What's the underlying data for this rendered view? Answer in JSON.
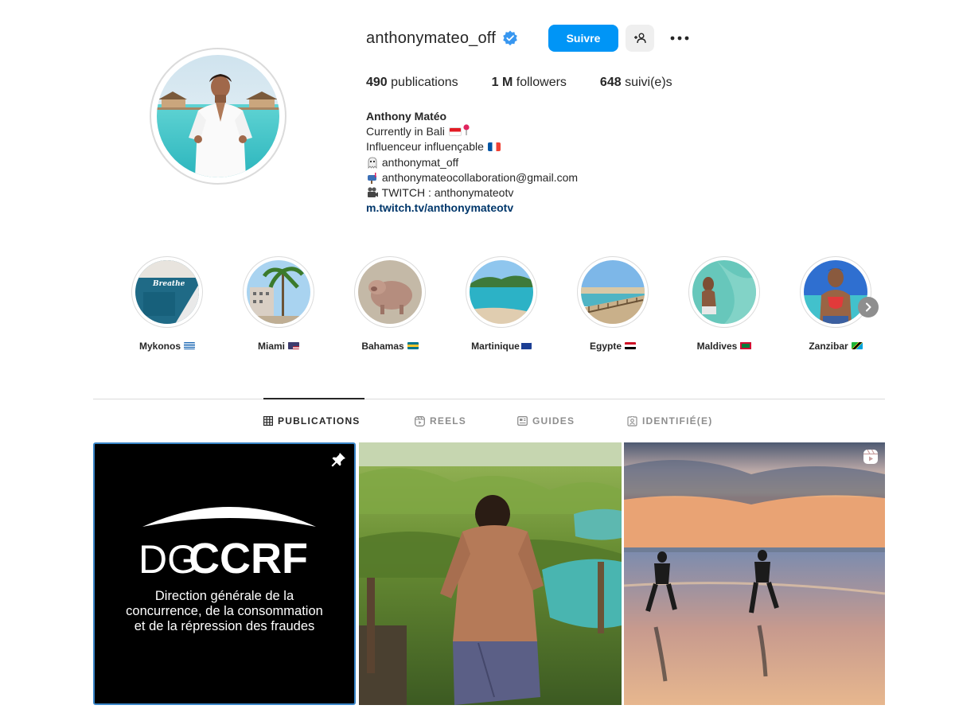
{
  "profile": {
    "username": "anthonymateo_off",
    "follow_label": "Suivre",
    "stats": [
      {
        "value": "490",
        "label": "publications"
      },
      {
        "value": "1 M",
        "label": "followers"
      },
      {
        "value": "648",
        "label": "suivi(e)s"
      }
    ],
    "bio": {
      "name": "Anthony Matéo",
      "line1": "Currently in Bali",
      "line2": "Influenceur influençable",
      "line3": "anthonymat_off",
      "line4": "anthonymateocollaboration@gmail.com",
      "line5": "TWITCH : anthonymateotv",
      "link": "m.twitch.tv/anthonymateotv"
    }
  },
  "highlights": [
    {
      "label": "Mykonos"
    },
    {
      "label": "Miami"
    },
    {
      "label": "Bahamas"
    },
    {
      "label": "Martinique"
    },
    {
      "label": "Egypte"
    },
    {
      "label": "Maldives"
    },
    {
      "label": "Zanzibar"
    }
  ],
  "tabs": [
    {
      "label": "PUBLICATIONS",
      "active": true
    },
    {
      "label": "REELS",
      "active": false
    },
    {
      "label": "GUIDES",
      "active": false
    },
    {
      "label": "IDENTIFIÉ(E)",
      "active": false
    }
  ],
  "posts": {
    "first": {
      "logo_left": "DG",
      "logo_right": "CCRF",
      "caption_1": "Direction générale de la",
      "caption_2": "concurrence, de la consommation",
      "caption_3": "et de la répression des fraudes"
    }
  },
  "highlight_overlay_text": "Breathe",
  "colors": {
    "accent": "#0095f6",
    "verified": "#3897f0",
    "link": "#00376b",
    "muted": "#8e8e8e",
    "border": "#dbdbdb"
  }
}
